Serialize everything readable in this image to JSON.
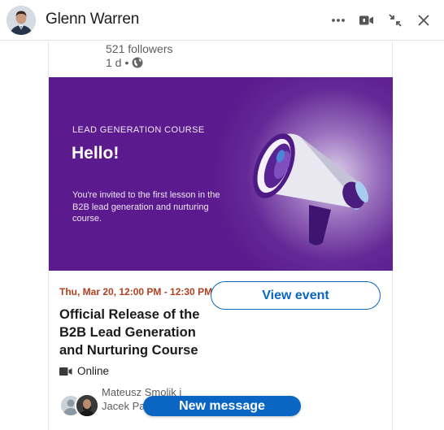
{
  "header": {
    "name": "Glenn Warren",
    "icons": [
      "more-icon",
      "video-call-icon",
      "minimize-icon",
      "close-icon"
    ]
  },
  "post": {
    "followers": "521 followers",
    "time": "1 d",
    "separator": "•"
  },
  "banner": {
    "course_label": "LEAD GENERATION COURSE",
    "greeting": "Hello!",
    "invite_text": "You're invited to the first lesson in the B2B lead generation and nurturing course.",
    "colors": {
      "background": "#5b1a8d"
    }
  },
  "event": {
    "date": "Thu, Mar 20, 12:00 PM - 12:30 PM",
    "title": "Official Release of the B2B Lead Generation and Nurturing Course",
    "location": "Online",
    "view_button": "View event",
    "attendee_line1": "Mateusz Smolik i",
    "attendee_line2": "Jacek Pa"
  },
  "new_message": "New message",
  "colors": {
    "accent": "#0a66c2",
    "date": "#b24020"
  }
}
